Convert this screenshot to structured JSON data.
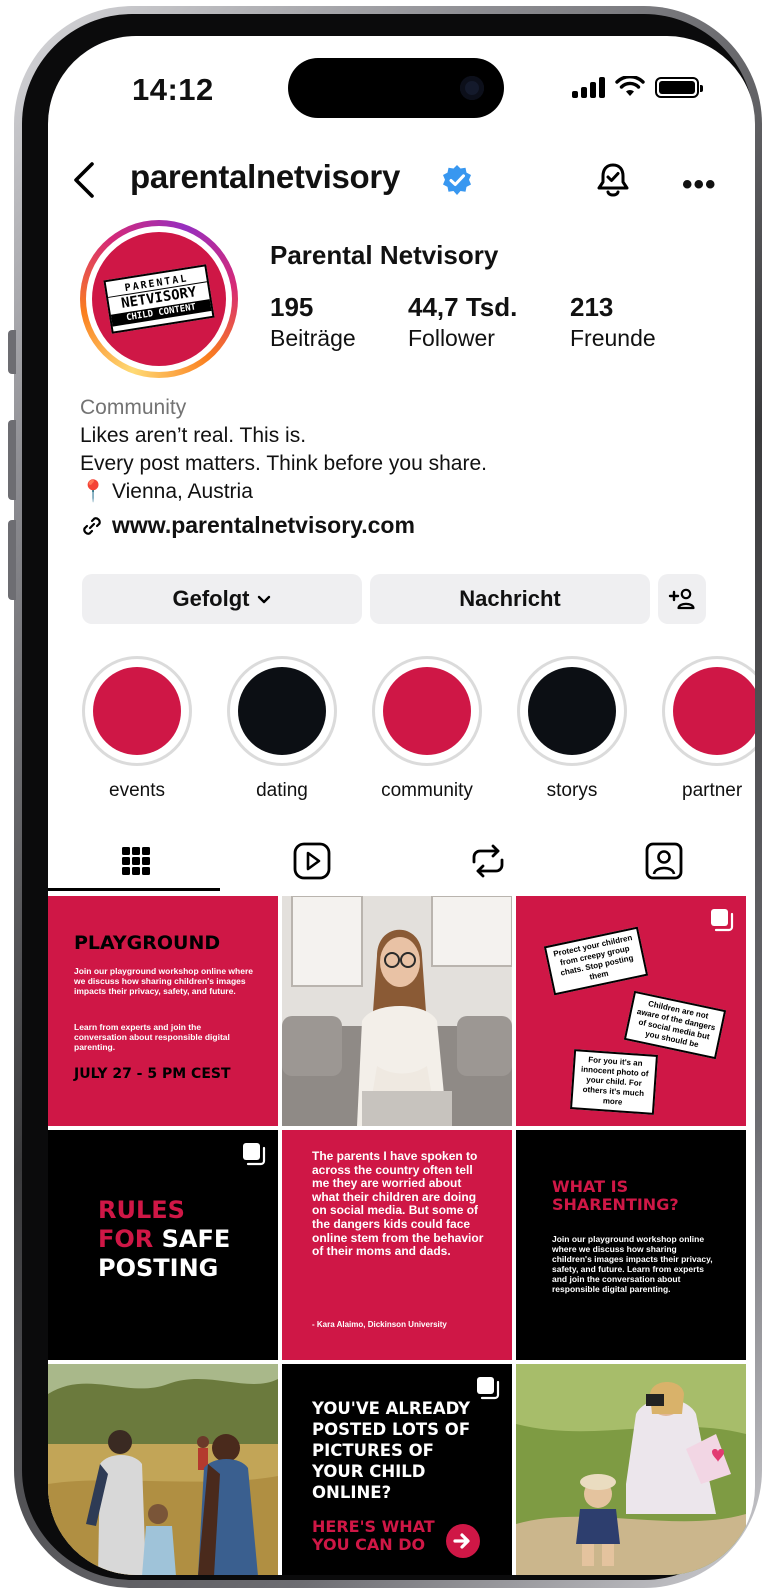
{
  "status_bar": {
    "time": "14:12"
  },
  "header": {
    "username": "parentalnetvisory"
  },
  "profile": {
    "display_name": "Parental Netvisory",
    "avatar_text": [
      "PARENTAL",
      "NETVISORY",
      "CHILD CONTENT"
    ],
    "stats": [
      {
        "number": "195",
        "label": "Beiträge"
      },
      {
        "number": "44,7 Tsd.",
        "label": "Follower"
      },
      {
        "number": "213",
        "label": "Freunde"
      }
    ],
    "bio": {
      "category": "Community",
      "line1": "Likes aren’t real. This is.",
      "line2": "Every post matters. Think before you share.",
      "location": "Vienna, Austria"
    },
    "link": "www.parentalnetvisory.com"
  },
  "actions": {
    "following": "Gefolgt",
    "message": "Nachricht"
  },
  "highlights": [
    {
      "label": "events",
      "color": "#cf1746"
    },
    {
      "label": "dating",
      "color": "#0c0f14"
    },
    {
      "label": "community",
      "color": "#cf1746"
    },
    {
      "label": "storys",
      "color": "#0c0f14"
    },
    {
      "label": "partner",
      "color": "#cf1746"
    }
  ],
  "tabs": [
    "grid-icon",
    "reels-icon",
    "reposts-icon",
    "tagged-icon"
  ],
  "posts": {
    "p1": {
      "title": "PLAYGROUND",
      "body1": "Join our playground workshop online where we discuss how sharing children's images impacts their privacy, safety, and future.",
      "body2": "Learn from experts and join the conversation about responsible digital parenting.",
      "date": "JULY 27 - 5 PM CEST"
    },
    "p3": {
      "note1": "Protect your children from creepy group chats. Stop posting them",
      "note2": "Children are not aware of the dangers of social media but you should be",
      "note3": "For you it's an innocent photo of your child. For others it's much more"
    },
    "p4": {
      "w1": "RULES",
      "w2": "FOR",
      "w3": "SAFE",
      "w4": "POSTING"
    },
    "p5": {
      "quote": "The parents I have spoken to across the country often tell me they are worried about what their children are doing on social media. But some of the dangers kids could face online stem from the behavior of their moms and dads.",
      "author": "- Kara Alaimo, Dickinson University"
    },
    "p6": {
      "title": "WHAT IS SHARENTING?",
      "body": "Join our playground workshop online where we discuss how sharing children's images impacts their privacy, safety, and future. Learn from experts and join the conversation about responsible digital parenting."
    },
    "p8": {
      "title": "YOU'VE ALREADY POSTED LOTS OF PICTURES OF YOUR CHILD ONLINE?",
      "cta": "HERE'S WHAT YOU CAN DO"
    }
  },
  "colors": {
    "brand_red": "#cf1746",
    "black": "#000000",
    "verified_blue": "#3897f0"
  }
}
